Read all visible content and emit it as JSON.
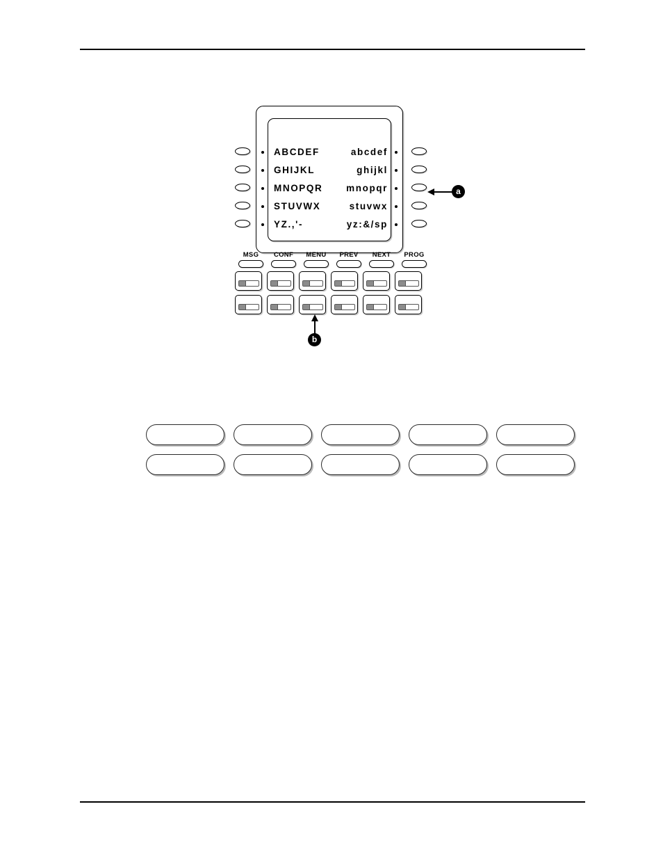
{
  "page": {
    "rules": {
      "top": true,
      "bottom": true
    }
  },
  "figure": {
    "name": "telephone-display-module",
    "display": {
      "rows": [
        {
          "left": "ABCDEF",
          "right": "abcdef"
        },
        {
          "left": "GHIJKL",
          "right": "ghijkl"
        },
        {
          "left": "MNOPQR",
          "right": "mnopqr"
        },
        {
          "left": "STUVWX",
          "right": "stuvwx"
        },
        {
          "left": "YZ.,'-",
          "right": "yz:&/sp"
        }
      ],
      "left_softkeys": 5,
      "right_softkeys": 5,
      "left_indicator_dots": 5,
      "right_indicator_dots": 5
    },
    "fixed_feature_keys": [
      {
        "label": "MSG"
      },
      {
        "label": "CONF"
      },
      {
        "label": "MENU"
      },
      {
        "label": "PREV"
      },
      {
        "label": "NEXT"
      },
      {
        "label": "PROG"
      }
    ],
    "key_grid": {
      "rows": 2,
      "columns": 6,
      "indicator_fill_color": "#8c8c8c"
    },
    "callouts": [
      {
        "id": "a",
        "label": "a",
        "points_to": "right-softkey-row-3",
        "direction": "left"
      },
      {
        "id": "b",
        "label": "b",
        "points_to": "key-row-2-column-3",
        "direction": "up"
      }
    ]
  },
  "label_strip": {
    "name": "blank-designation-labels",
    "rows": 2,
    "columns": 5,
    "cells": [
      [
        "",
        "",
        "",
        "",
        ""
      ],
      [
        "",
        "",
        "",
        "",
        ""
      ]
    ]
  }
}
